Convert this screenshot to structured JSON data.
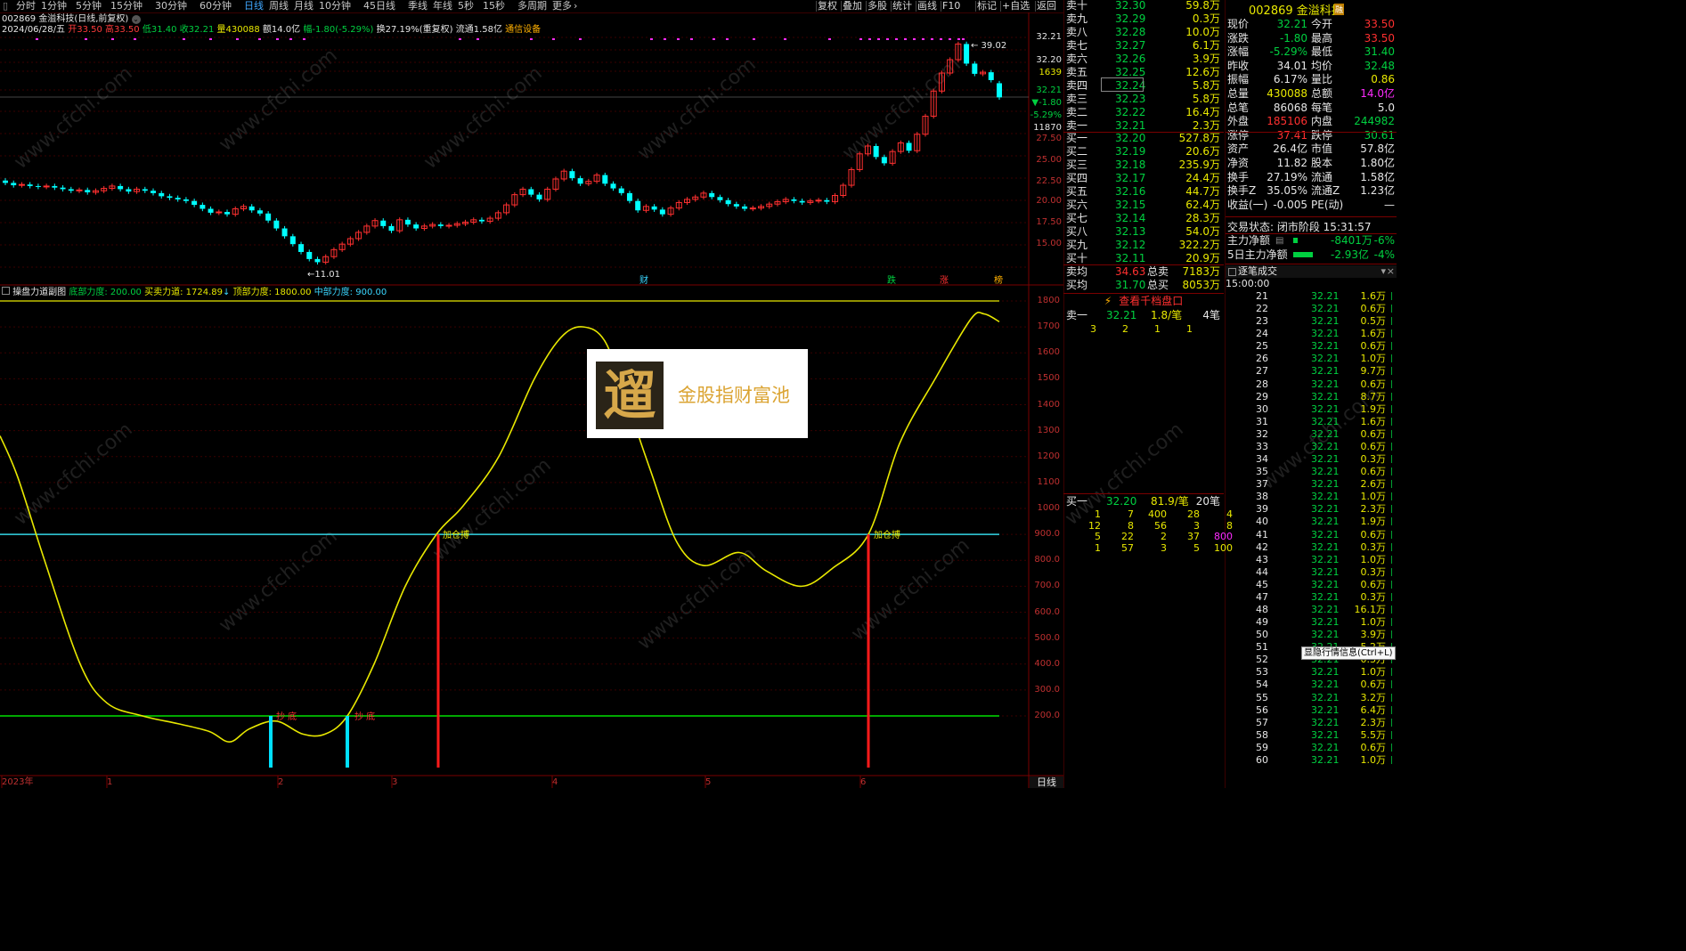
{
  "toolbar": {
    "periods": [
      "分时",
      "1分钟",
      "5分钟",
      "15分钟",
      "30分钟",
      "60分钟",
      "日线",
      "周线",
      "月线",
      "10分钟",
      "45日线",
      "季线",
      "年线",
      "5秒",
      "15秒",
      "多周期",
      "更多"
    ],
    "selected": "日线",
    "right_buttons": [
      "复权",
      "叠加",
      "多股",
      "统计",
      "画线",
      "F10",
      "标记",
      "+自选",
      "返回"
    ]
  },
  "stock": {
    "title": "002869 金溢科技(日线,前复权)",
    "date": "2024/06/28/五",
    "open": "开33.50",
    "high": "高33.50",
    "low": "低31.40",
    "close": "收32.21",
    "volume": "量430088",
    "amount": "额14.0亿",
    "change": "幅-1.80(-5.29%)",
    "turnover": "换27.19%(重复权)",
    "float": "流通1.58亿",
    "sector": "通信设备"
  },
  "kline_axis": [
    "32.21",
    "32.20",
    "1639",
    "32.21",
    "▼-1.80",
    "-5.29%",
    "11870",
    "27.50",
    "25.00",
    "22.50",
    "20.00",
    "17.50",
    "15.00"
  ],
  "kline_marks": {
    "high": "39.02",
    "low": "11.01",
    "fin": "财",
    "die": "跌",
    "zhang": "涨",
    "bang": "榜"
  },
  "indicator": {
    "name": "操盘力道副图",
    "bottom_label": "底部力度: 200.00",
    "flow_label": "买卖力道: 1724.89",
    "top_label": "顶部力度: 1800.00",
    "mid_label": "中部力度: 900.00",
    "axis": [
      "1800",
      "1700",
      "1600",
      "1500",
      "1400",
      "1300",
      "1200",
      "1100",
      "1000",
      "900.0",
      "800.0",
      "700.0",
      "600.0",
      "500.0",
      "400.0",
      "300.0",
      "200.0"
    ],
    "signal1": "加仓搏",
    "signal2": "加仓搏",
    "bottom_sig": "抄 底"
  },
  "xaxis": [
    "2023年",
    "1",
    "2",
    "3",
    "4",
    "5",
    "6"
  ],
  "xaxis_tab": "日线",
  "logo": {
    "text": "金股指财富池",
    "glyph": "遛"
  },
  "orderbook": {
    "sell": [
      {
        "label": "卖十",
        "price": "32.30",
        "vol": "59.8万"
      },
      {
        "label": "卖九",
        "price": "32.29",
        "vol": "0.3万"
      },
      {
        "label": "卖八",
        "price": "32.28",
        "vol": "10.0万"
      },
      {
        "label": "卖七",
        "price": "32.27",
        "vol": "6.1万"
      },
      {
        "label": "卖六",
        "price": "32.26",
        "vol": "3.9万"
      },
      {
        "label": "卖五",
        "price": "32.25",
        "vol": "12.6万"
      },
      {
        "label": "卖四",
        "price": "32.24",
        "vol": "5.8万"
      },
      {
        "label": "卖三",
        "price": "32.23",
        "vol": "5.8万"
      },
      {
        "label": "卖二",
        "price": "32.22",
        "vol": "16.4万"
      },
      {
        "label": "卖一",
        "price": "32.21",
        "vol": "2.3万"
      }
    ],
    "buy": [
      {
        "label": "买一",
        "price": "32.20",
        "vol": "527.8万"
      },
      {
        "label": "买二",
        "price": "32.19",
        "vol": "20.6万"
      },
      {
        "label": "买三",
        "price": "32.18",
        "vol": "235.9万"
      },
      {
        "label": "买四",
        "price": "32.17",
        "vol": "24.4万"
      },
      {
        "label": "买五",
        "price": "32.16",
        "vol": "44.7万"
      },
      {
        "label": "买六",
        "price": "32.15",
        "vol": "62.4万"
      },
      {
        "label": "买七",
        "price": "32.14",
        "vol": "28.3万"
      },
      {
        "label": "买八",
        "price": "32.13",
        "vol": "54.0万"
      },
      {
        "label": "买九",
        "price": "32.12",
        "vol": "322.2万"
      },
      {
        "label": "买十",
        "price": "32.11",
        "vol": "20.9万"
      }
    ],
    "avg_sell_label": "卖均",
    "avg_sell": "34.63",
    "total_sell_label": "总卖",
    "total_sell": "7183万",
    "avg_buy_label": "买均",
    "avg_buy": "31.70",
    "total_buy_label": "总买",
    "total_buy": "8053万",
    "thousand_link": "查看千档盘口",
    "sell1_queue": {
      "label": "卖一",
      "price": "32.21",
      "per": "1.8/笔",
      "count": "4笔",
      "items": [
        "3",
        "2",
        "1",
        "1"
      ]
    },
    "buy1_queue": {
      "label": "买一",
      "price": "32.20",
      "per": "81.9/笔",
      "count": "20笔",
      "rows": [
        [
          "1",
          "7",
          "400",
          "28",
          "4"
        ],
        [
          "12",
          "8",
          "56",
          "3",
          "8"
        ],
        [
          "5",
          "22",
          "2",
          "37",
          "800"
        ],
        [
          "1",
          "57",
          "3",
          "5",
          "100"
        ]
      ]
    }
  },
  "quote": {
    "code_name": "002869 金溢科技",
    "badge": "融",
    "rows": [
      [
        "现价",
        "32.21",
        "今开",
        "33.50"
      ],
      [
        "涨跌",
        "-1.80",
        "最高",
        "33.50"
      ],
      [
        "涨幅",
        "-5.29%",
        "最低",
        "31.40"
      ],
      [
        "昨收",
        "34.01",
        "均价",
        "32.48"
      ],
      [
        "振幅",
        "6.17%",
        "量比",
        "0.86"
      ],
      [
        "总量",
        "430088",
        "总额",
        "14.0亿"
      ],
      [
        "总笔",
        "86068",
        "每笔",
        "5.0"
      ],
      [
        "外盘",
        "185106",
        "内盘",
        "244982"
      ],
      [
        "涨停",
        "37.41",
        "跌停",
        "30.61"
      ],
      [
        "资产",
        "26.4亿",
        "市值",
        "57.8亿"
      ],
      [
        "净资",
        "11.82",
        "股本",
        "1.80亿"
      ],
      [
        "换手",
        "27.19%",
        "流通",
        "1.58亿"
      ],
      [
        "换手Z",
        "35.05%",
        "流通Z",
        "1.23亿"
      ],
      [
        "收益(一)",
        "-0.005",
        "PE(动)",
        "—"
      ]
    ],
    "trade_state": "交易状态: 闭市阶段 15:31:57",
    "main_flow_label": "主力净额",
    "main_flow": "-8401万",
    "main_flow_pct": "-6%",
    "main5_label": "5日主力净额",
    "main5": "-2.93亿",
    "main5_pct": "-4%"
  },
  "ticks": {
    "header": "逐笔成交",
    "first_time": "15:00:00",
    "rows": [
      [
        "21",
        "32.21",
        "1.6万"
      ],
      [
        "22",
        "32.21",
        "0.6万"
      ],
      [
        "23",
        "32.21",
        "0.5万"
      ],
      [
        "24",
        "32.21",
        "1.6万"
      ],
      [
        "25",
        "32.21",
        "0.6万"
      ],
      [
        "26",
        "32.21",
        "1.0万"
      ],
      [
        "27",
        "32.21",
        "9.7万"
      ],
      [
        "28",
        "32.21",
        "0.6万"
      ],
      [
        "29",
        "32.21",
        "8.7万"
      ],
      [
        "30",
        "32.21",
        "1.9万"
      ],
      [
        "31",
        "32.21",
        "1.6万"
      ],
      [
        "32",
        "32.21",
        "0.6万"
      ],
      [
        "33",
        "32.21",
        "0.6万"
      ],
      [
        "34",
        "32.21",
        "0.3万"
      ],
      [
        "35",
        "32.21",
        "0.6万"
      ],
      [
        "37",
        "32.21",
        "2.6万"
      ],
      [
        "38",
        "32.21",
        "1.0万"
      ],
      [
        "39",
        "32.21",
        "2.3万"
      ],
      [
        "40",
        "32.21",
        "1.9万"
      ],
      [
        "41",
        "32.21",
        "0.6万"
      ],
      [
        "42",
        "32.21",
        "0.3万"
      ],
      [
        "43",
        "32.21",
        "1.0万"
      ],
      [
        "44",
        "32.21",
        "0.3万"
      ],
      [
        "45",
        "32.21",
        "0.6万"
      ],
      [
        "47",
        "32.21",
        "0.3万"
      ],
      [
        "48",
        "32.21",
        "16.1万"
      ],
      [
        "49",
        "32.21",
        "1.0万"
      ],
      [
        "50",
        "32.21",
        "3.9万"
      ],
      [
        "51",
        "32.21",
        "5.2万"
      ],
      [
        "52",
        "32.21",
        "0.3万"
      ],
      [
        "53",
        "32.21",
        "1.0万"
      ],
      [
        "54",
        "32.21",
        "0.6万"
      ],
      [
        "55",
        "32.21",
        "3.2万"
      ],
      [
        "56",
        "32.21",
        "6.4万"
      ],
      [
        "57",
        "32.21",
        "2.3万"
      ],
      [
        "58",
        "32.21",
        "5.5万"
      ],
      [
        "59",
        "32.21",
        "0.6万"
      ],
      [
        "60",
        "32.21",
        "1.0万"
      ]
    ],
    "tooltip": "显隐行情信息(Ctrl+L)"
  },
  "colors": {
    "up": "#ff3030",
    "down": "#00ffff",
    "line": "#e8e800",
    "mid": "#33d6e6",
    "bottom": "#00e000"
  }
}
